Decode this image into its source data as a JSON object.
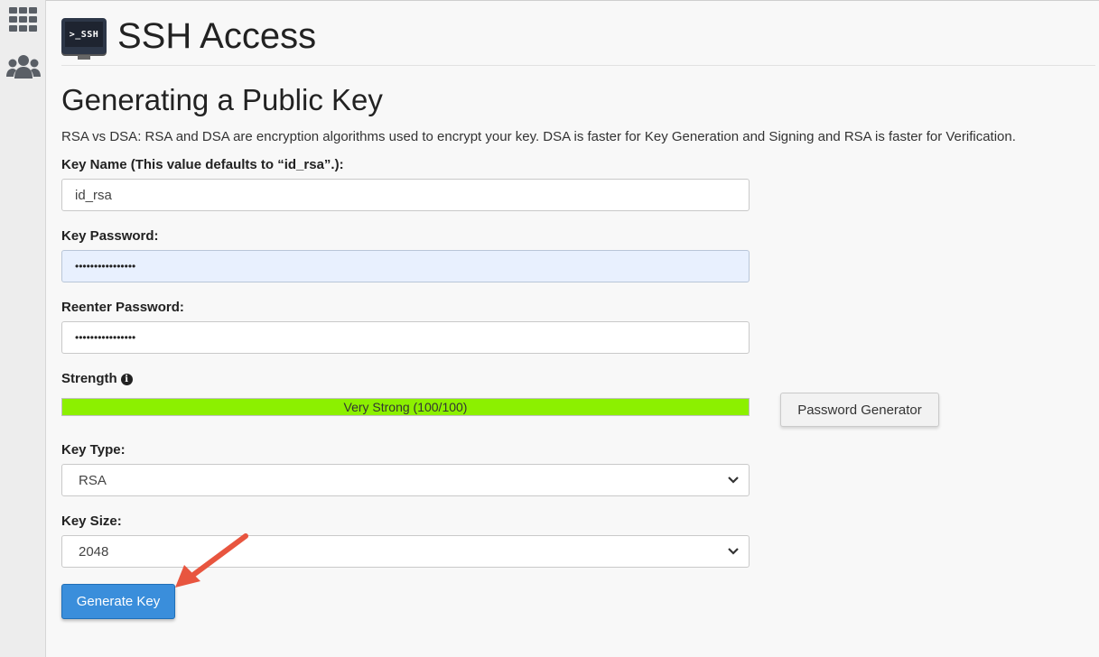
{
  "sidebar": {
    "icons": [
      "apps-grid-icon",
      "users-icon"
    ]
  },
  "header": {
    "logo_text": ">_SSH",
    "title": "SSH Access"
  },
  "section": {
    "title": "Generating a Public Key",
    "description": "RSA vs DSA: RSA and DSA are encryption algorithms used to encrypt your key. DSA is faster for Key Generation and Signing and RSA is faster for Verification."
  },
  "form": {
    "key_name": {
      "label": "Key Name (This value defaults to “id_rsa”.):",
      "value": "id_rsa"
    },
    "key_password": {
      "label": "Key Password:",
      "value": "••••••••••••••••"
    },
    "reenter_password": {
      "label": "Reenter Password:",
      "value": "••••••••••••••••"
    },
    "strength": {
      "label": "Strength",
      "text": "Very Strong (100/100)",
      "level": 1.0,
      "color": "#8cf000"
    },
    "password_generator_label": "Password Generator",
    "key_type": {
      "label": "Key Type:",
      "selected": "RSA"
    },
    "key_size": {
      "label": "Key Size:",
      "selected": "2048"
    },
    "submit_label": "Generate Key"
  },
  "colors": {
    "primary": "#3a8edb",
    "arrow": "#e8553f"
  }
}
